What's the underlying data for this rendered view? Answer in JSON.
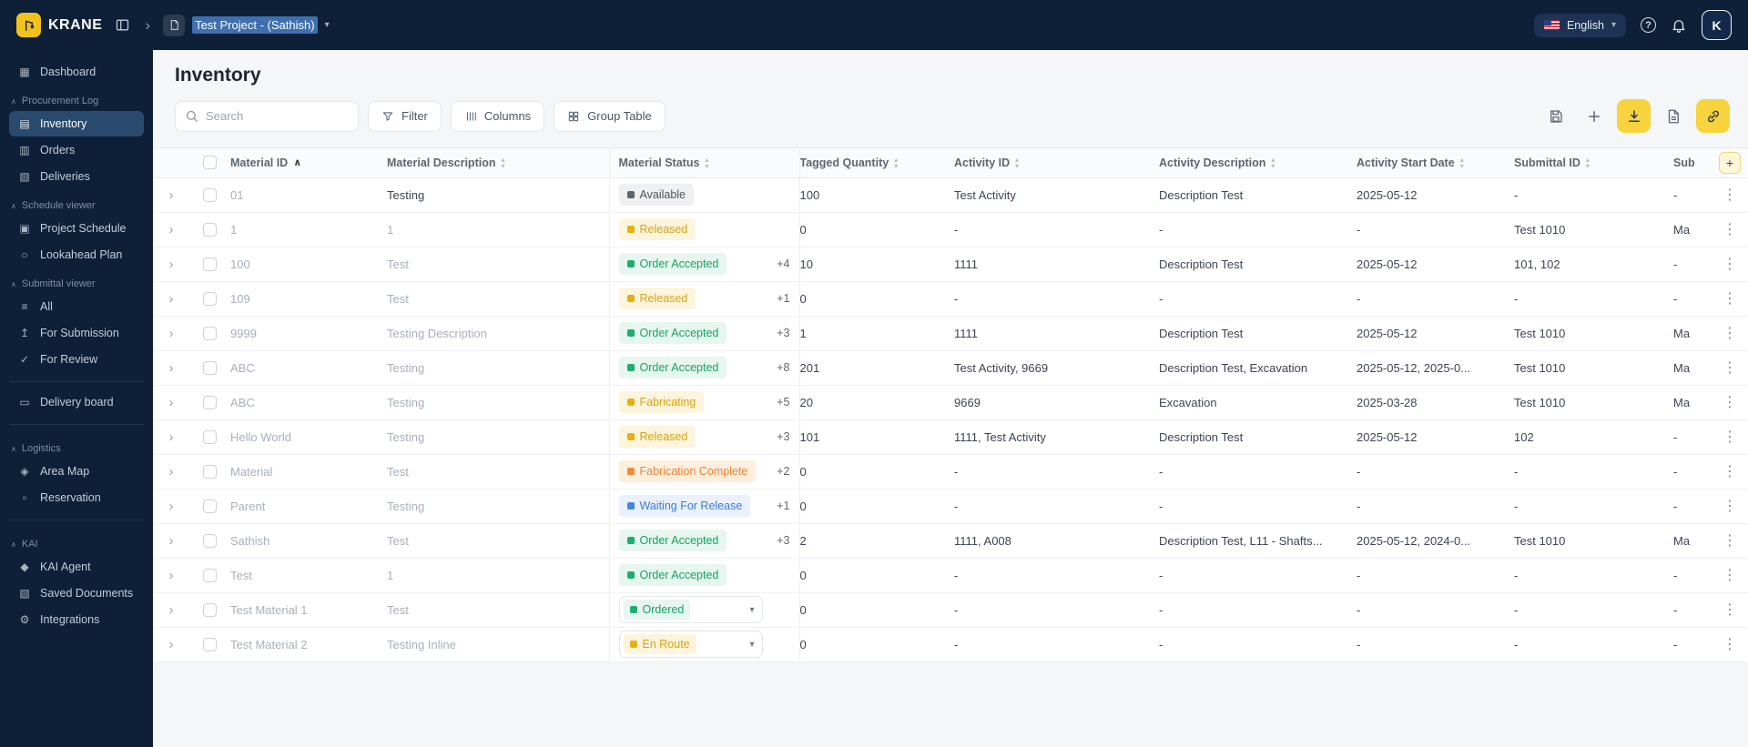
{
  "topbar": {
    "brand": "KRANE",
    "project_name": "Test Project - (Sathish)",
    "language_label": "English",
    "avatar_initial": "K"
  },
  "page": {
    "title": "Inventory"
  },
  "toolbar": {
    "search_placeholder": "Search",
    "filter_label": "Filter",
    "columns_label": "Columns",
    "group_table_label": "Group Table"
  },
  "icons": {
    "section_caret": "∧",
    "breadcrumb_chevron": "›",
    "dropdown_caret": "▾",
    "kebab": "⋮",
    "expand_chevron": "›",
    "sort_asc": "∧",
    "sort_up": "▴",
    "sort_down": "▾",
    "add": "+"
  },
  "colors": {
    "brand_yellow": "#F2C21C",
    "topbar_navy": "#0E2038",
    "status_green": "#17A267",
    "status_amber": "#D9A40E",
    "status_orange": "#EF8432",
    "status_blue": "#3D7CD8"
  },
  "sidebar": {
    "sections": [
      {
        "items": [
          {
            "label": "Dashboard",
            "icon": "dashboard-icon",
            "glyph": "▦"
          }
        ]
      },
      {
        "title": "Procurement Log",
        "items": [
          {
            "label": "Inventory",
            "icon": "inventory-icon",
            "glyph": "▤",
            "active": true
          },
          {
            "label": "Orders",
            "icon": "orders-icon",
            "glyph": "▥"
          },
          {
            "label": "Deliveries",
            "icon": "deliveries-icon",
            "glyph": "▨"
          }
        ]
      },
      {
        "title": "Schedule viewer",
        "items": [
          {
            "label": "Project Schedule",
            "icon": "project-schedule-icon",
            "glyph": "▣"
          },
          {
            "label": "Lookahead Plan",
            "icon": "lookahead-plan-icon",
            "glyph": "○"
          }
        ]
      },
      {
        "title": "Submittal viewer",
        "items": [
          {
            "label": "All",
            "icon": "all-submittals-icon",
            "glyph": "≡"
          },
          {
            "label": "For Submission",
            "icon": "for-submission-icon",
            "glyph": "↥"
          },
          {
            "label": "For Review",
            "icon": "for-review-icon",
            "glyph": "✓"
          }
        ]
      },
      {
        "divider": true,
        "items": [
          {
            "label": "Delivery board",
            "icon": "delivery-board-icon",
            "glyph": "▭"
          }
        ]
      },
      {
        "divider": true,
        "title": "Logistics",
        "items": [
          {
            "label": "Area Map",
            "icon": "area-map-icon",
            "glyph": "◈"
          },
          {
            "label": "Reservation",
            "icon": "reservation-icon",
            "glyph": "▫"
          }
        ]
      },
      {
        "divider": true,
        "title": "KAI",
        "items": [
          {
            "label": "KAI Agent",
            "icon": "kai-agent-icon",
            "glyph": "◆"
          },
          {
            "label": "Saved Documents",
            "icon": "saved-documents-icon",
            "glyph": "▧"
          },
          {
            "label": "Integrations",
            "icon": "integrations-icon",
            "glyph": "⚙"
          }
        ]
      }
    ]
  },
  "table": {
    "columns": [
      "Material ID",
      "Material Description",
      "Material Status",
      "Tagged Quantity",
      "Activity ID",
      "Activity Description",
      "Activity Start Date",
      "Submittal ID",
      "Sub"
    ],
    "sorted_column": "Material ID",
    "rows": [
      {
        "id": "01",
        "desc": "Testing",
        "desc_dark": true,
        "status": {
          "label": "Available",
          "type": "neutral",
          "count": ""
        },
        "qty": "100",
        "act_id": "Test Activity",
        "act_desc": "Description Test",
        "date": "2025-05-12",
        "sub_id": "-",
        "sub": "-"
      },
      {
        "id": "1",
        "desc": "1",
        "status": {
          "label": "Released",
          "type": "amber",
          "count": ""
        },
        "qty": "0",
        "act_id": "-",
        "act_desc": "-",
        "date": "-",
        "sub_id": "Test 1010",
        "sub": "Ma"
      },
      {
        "id": "100",
        "desc": "Test",
        "status": {
          "label": "Order Accepted",
          "type": "green",
          "count": "+4"
        },
        "qty": "10",
        "act_id": "1111",
        "act_desc": "Description Test",
        "date": "2025-05-12",
        "sub_id": "101, 102",
        "sub": "-"
      },
      {
        "id": "109",
        "desc": "Test",
        "status": {
          "label": "Released",
          "type": "amber",
          "count": "+1"
        },
        "qty": "0",
        "act_id": "-",
        "act_desc": "-",
        "date": "-",
        "sub_id": "-",
        "sub": "-"
      },
      {
        "id": "9999",
        "desc": "Testing Description",
        "status": {
          "label": "Order Accepted",
          "type": "green",
          "count": "+3"
        },
        "qty": "1",
        "act_id": "1111",
        "act_desc": "Description Test",
        "date": "2025-05-12",
        "sub_id": "Test 1010",
        "sub": "Ma"
      },
      {
        "id": "ABC",
        "desc": "Testing",
        "status": {
          "label": "Order Accepted",
          "type": "green",
          "count": "+8"
        },
        "qty": "201",
        "act_id": "Test Activity, 9669",
        "act_desc": "Description Test, Excavation",
        "date": "2025-05-12, 2025-0...",
        "sub_id": "Test 1010",
        "sub": "Ma"
      },
      {
        "id": "ABC",
        "desc": "Testing",
        "status": {
          "label": "Fabricating",
          "type": "amber",
          "count": "+5"
        },
        "qty": "20",
        "act_id": "9669",
        "act_desc": "Excavation",
        "date": "2025-03-28",
        "sub_id": "Test 1010",
        "sub": "Ma"
      },
      {
        "id": "Hello World",
        "desc": "Testing",
        "status": {
          "label": "Released",
          "type": "amber",
          "count": "+3"
        },
        "qty": "101",
        "act_id": "1111, Test Activity",
        "act_desc": "Description Test",
        "date": "2025-05-12",
        "sub_id": "102",
        "sub": "-"
      },
      {
        "id": "Material",
        "desc": "Test",
        "status": {
          "label": "Fabrication Complete",
          "type": "orange",
          "count": "+2"
        },
        "qty": "0",
        "act_id": "-",
        "act_desc": "-",
        "date": "-",
        "sub_id": "-",
        "sub": "-"
      },
      {
        "id": "Parent",
        "desc": "Testing",
        "status": {
          "label": "Waiting For Release",
          "type": "blue",
          "count": "+1"
        },
        "qty": "0",
        "act_id": "-",
        "act_desc": "-",
        "date": "-",
        "sub_id": "-",
        "sub": "-"
      },
      {
        "id": "Sathish",
        "desc": "Test",
        "status": {
          "label": "Order Accepted",
          "type": "green",
          "count": "+3"
        },
        "qty": "2",
        "act_id": "1111, A008",
        "act_desc": "Description Test, L11 - Shafts...",
        "date": "2025-05-12, 2024-0...",
        "sub_id": "Test 1010",
        "sub": "Ma"
      },
      {
        "id": "Test",
        "desc": "1",
        "status": {
          "label": "Order Accepted",
          "type": "green",
          "count": ""
        },
        "qty": "0",
        "act_id": "-",
        "act_desc": "-",
        "date": "-",
        "sub_id": "-",
        "sub": "-"
      },
      {
        "id": "Test Material 1",
        "desc": "Test",
        "status": {
          "label": "Ordered",
          "type": "green",
          "count": "",
          "dropdown": true
        },
        "qty": "0",
        "act_id": "-",
        "act_desc": "-",
        "date": "-",
        "sub_id": "-",
        "sub": "-"
      },
      {
        "id": "Test Material 2",
        "desc": "Testing Inline",
        "status": {
          "label": "En Route",
          "type": "amber",
          "count": "",
          "dropdown": true
        },
        "qty": "0",
        "act_id": "-",
        "act_desc": "-",
        "date": "-",
        "sub_id": "-",
        "sub": "-"
      }
    ]
  }
}
